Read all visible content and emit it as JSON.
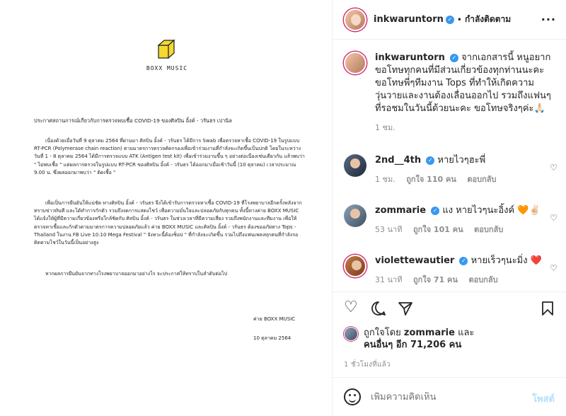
{
  "document": {
    "logo_text": "BOXX MUSIC",
    "title": "ประกาศสถานการณ์เกี่ยวกับการตรวจพบเชื้อ COVID-19 ของศิลปิน อิ้งค์ - วรันธร เปานิล",
    "paragraph1": "เนื่องด้วยเมื่อวันที่ 9 ตุลาคม 2564 ที่ผ่านมา ศิลปิน อิ้งค์ - วรันธร ได้มีการ Swab เพื่อตรวจหาเชื้อ COVID-19 ในรูปแบบ\nRT-PCR (Polymerase chain reaction) ตามมาตรการตรวจคัดกรองเพื่อเข้าร่วมงานที่กำลังจะเกิดขึ้นเป็นปกติ โดยในระหว่าง\nวันที่ 1 - 8 ตุลาคม 2564 ได้มีการตรวจแบบ ATK (Antigen test kit) เพื่อเข้าร่วมงานขึ้น ๆ อย่างต่อเนื่องเช่นเดียวกัน แล้วพบว่า\n\" ไม่พบเชื้อ \" แต่ผลการตรวจในรูปแบบ RT-PCR ของศิลปิน อิ้งค์ - วรันธร ได้ออกมาเมื่อเช้าวันนี้ (10 ตุลาคม) เวลาประมาณ\n9.00 น. ซึ่งผลออกมาพบว่า \" ติดเชื้อ \"",
    "paragraph2": "เพื่อเป็นการยืนยันให้แน่ชัด ทางศิลปิน อิ้งค์ - วรันธร จึงได้เข้ารับการตรวจหาเชื้อ COVID-19 ที่โรงพยาบาลอีกครั้งหลังจาก\nทราบข่าวทันที และได้ทำการกักตัว รวมถึงงดการแสดงโชว์ เพื่อความมั่นใจและปลอดภัยกับทุกคน ทั้งนี้ทางค่าย BOXX MUSIC\nได้แจ้งให้ผู้ที่มีความเกี่ยวข้องหรือใกล้ชิดกับ ศิลปิน อิ้งค์ - วรันธร ในช่วงเวลาที่มีความเสี่ยง รวมถึงพนักงานและทีมงาน เพื่อให้\nตรวจหาเชื้อและกักตัวตามมาตรการความปลอดภัยแล้ว ค่าย BOXX MUSIC และศิลปิน อิ้งค์ - วรันธร ต้องขออภัยทาง Tops -\nThailand ในงาน FB Live 10.10 Mega Festival \" จังหวะนี้ต้องช็อป \" ที่กำลังจะเกิดขึ้น รวมไปถึงแฟนเพลงทุกคนที่กำลังรอ\nติดตามโชว์ในวันนี้เป็นอย่างสูง",
    "paragraph3": "หากผลการยืนยันจากทางโรงพยาบาลออกมาอย่างไร จะประกาศให้ทราบในลำดับต่อไป",
    "sign_company": "ค่าย BOXX MUSIC",
    "sign_date": "10 ตุลาคม 2564"
  },
  "header": {
    "username": "inkwaruntorn",
    "verified": "✓",
    "dot": "•",
    "follow_status": "กำลังติดตาม",
    "more": "···"
  },
  "caption": {
    "username": "inkwaruntorn",
    "verified": "✓",
    "text": "จากเอกสารนี้ หนูอยากขอโทษทุกคนที่มีส่วนเกี่ยวข้องทุกท่านนะคะ ขอโทษพี่ๆทีมงาน Tops ที่ทำให้เกิดความวุ่นวายและงานต้องเลื่อนออกไป รวมถึงแฟนๆที่รอชมในวันนี้ด้วยนะคะ ขอโทษจริงๆค่ะ🙏🏻",
    "time": "1 ชม."
  },
  "comments": [
    {
      "username": "2nd__4th",
      "verified": "✓",
      "text": "หายไวๆฮะพี่",
      "time": "1 ชม.",
      "likes": "ถูกใจ 110 คน",
      "reply": "ตอบกลับ"
    },
    {
      "username": "zommarie",
      "verified": "✓",
      "text": "แง หายไวๆนะอิ้งค์ 🧡✌🏻",
      "time": "53 นาที",
      "likes": "ถูกใจ 101 คน",
      "reply": "ตอบกลับ"
    },
    {
      "username": "violettewautier",
      "verified": "✓",
      "text": "หายเร็วๆนะมิ่ง ❤️",
      "time": "31 นาที",
      "likes": "ถูกใจ 71 คน",
      "reply": "ตอบกลับ"
    }
  ],
  "likes_summary": {
    "prefix": "ถูกใจโดย ",
    "user": "zommarie",
    "mid": " และ",
    "others": "คนอื่นๆ อีก 71,206 คน"
  },
  "post_time": "1 ชั่วโมงที่แล้ว",
  "add_comment": {
    "placeholder": "เพิ่มความคิดเห็น",
    "post_label": "โพสต์"
  },
  "colors": {
    "verified": "#3897f0",
    "post_button": "#b2dffc",
    "story_ring": "#d62976"
  }
}
